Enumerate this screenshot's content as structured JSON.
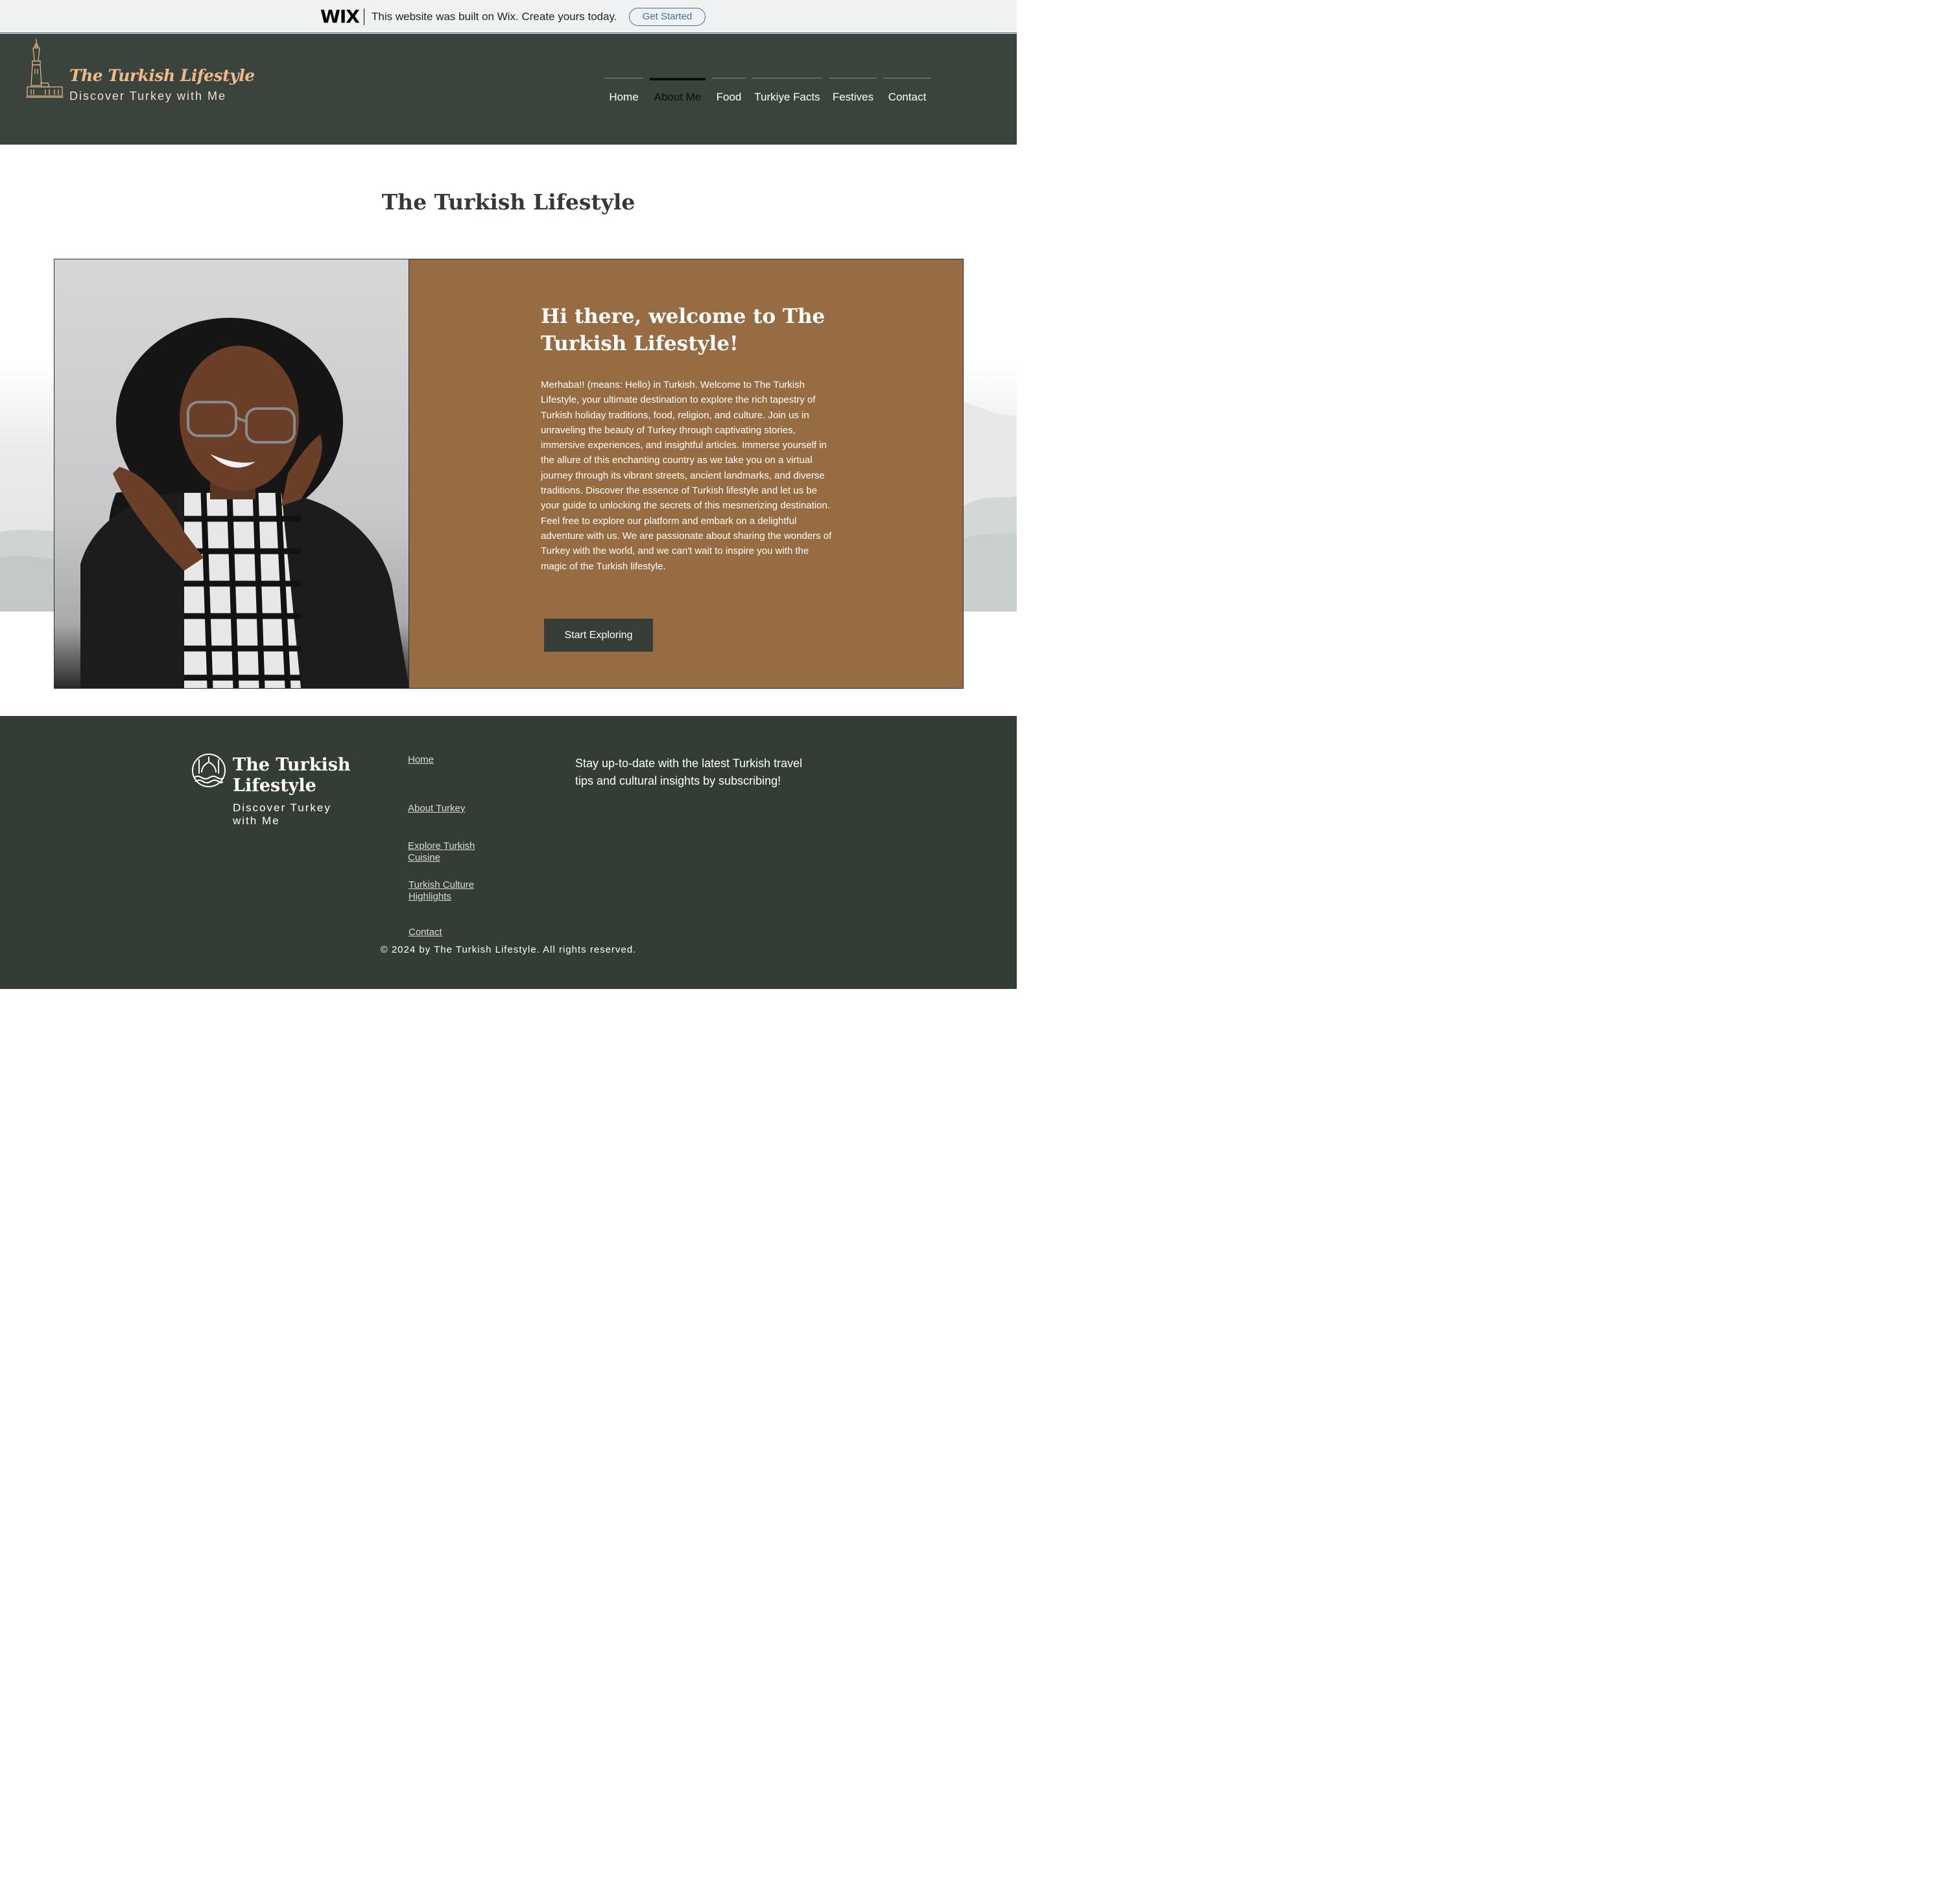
{
  "wix_banner": {
    "logo": "WIX",
    "text": "This website was built on Wix. Create yours today.",
    "button": "Get Started"
  },
  "header": {
    "brand_title": "The Turkish Lifestyle",
    "brand_subtitle": "Discover Turkey with Me",
    "nav": [
      {
        "label": "Home",
        "active": false
      },
      {
        "label": "About Me",
        "active": true
      },
      {
        "label": "Food",
        "active": false
      },
      {
        "label": "Turkiye Facts",
        "active": false
      },
      {
        "label": "Festives",
        "active": false
      },
      {
        "label": "Contact",
        "active": false
      }
    ]
  },
  "main": {
    "page_title": "The Turkish Lifestyle",
    "hero_heading": "Hi there, welcome to The Turkish Lifestyle!",
    "hero_body_1": "Merhaba!! (means: Hello) in Turkish. Welcome to The Turkish Lifestyle, your ultimate destination to explore the rich tapestry of Turkish holiday traditions, food, religion, and culture. Join us in unraveling the beauty of Turkey through captivating stories, immersive experiences, and insightful articles. Immerse yourself in the allure of this enchanting country as we take you on a virtual journey through its vibrant streets, ancient landmarks, and diverse traditions. Discover the essence of Turkish lifestyle and let us be your guide to unlocking the secrets of this mesmerizing destination.",
    "hero_body_2": "Feel free to explore our platform and embark on a delightful adventure with us. We are passionate about sharing the wonders of Turkey with the world, and we can't wait to inspire you with the magic of the Turkish lifestyle.",
    "cta": "Start Exploring"
  },
  "footer": {
    "brand_title": "The Turkish Lifestyle",
    "brand_subtitle": "Discover Turkey with Me",
    "links": [
      "Home",
      "About Turkey",
      "Explore Turkish Cuisine",
      "Turkish Culture Highlights",
      "Contact"
    ],
    "newsletter": "Stay up-to-date with the latest Turkish travel tips and cultural insights by subscribing!",
    "copyright": "© 2024 by The Turkish Lifestyle. All rights reserved."
  },
  "colors": {
    "header_bg": "#3a443c",
    "accent_brown": "#976c42",
    "brand_peach": "#f0b98b",
    "footer_bg": "#343c36",
    "button_dark": "#363e37",
    "wix_blue": "#3d6ea3"
  },
  "icons": {
    "header_logo": "maiden-tower-icon",
    "footer_logo": "mosque-emblem-icon"
  }
}
